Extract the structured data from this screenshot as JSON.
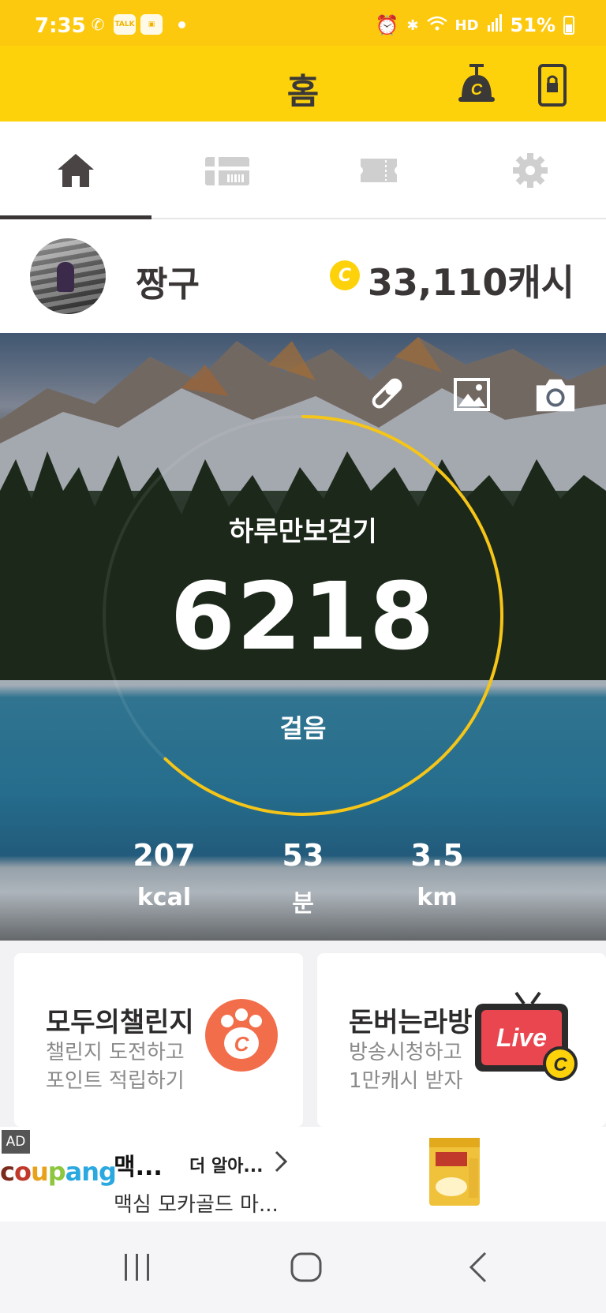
{
  "status_bar": {
    "time": "7:35",
    "left_icons": [
      "phone-alert-icon",
      "kakaotalk-icon",
      "kakao-story-icon"
    ],
    "right_icons": [
      "alarm-icon",
      "bluetooth-icon",
      "wifi-icon",
      "hd-voice-icon",
      "signal-icon"
    ],
    "hd_label": "HD",
    "battery": "51%"
  },
  "header": {
    "title": "홈",
    "accent_color": "#fdd20b"
  },
  "tabs": [
    {
      "icon": "home-icon",
      "selected": true
    },
    {
      "icon": "gift-card-icon",
      "selected": false
    },
    {
      "icon": "ticket-icon",
      "selected": false
    },
    {
      "icon": "gear-icon",
      "selected": false
    }
  ],
  "profile": {
    "name": "짱구",
    "coin_symbol": "C",
    "cash": "33,110캐시"
  },
  "hero": {
    "tools": [
      "pen-icon",
      "image-icon",
      "camera-icon"
    ],
    "title": "하루만보걷기",
    "steps": "6218",
    "steps_unit": "걸음",
    "goal_progress": 0.6218,
    "ring_color": "#f5c518",
    "stats": [
      {
        "value": "207",
        "unit": "kcal"
      },
      {
        "value": "53",
        "unit": "분"
      },
      {
        "value": "3.5",
        "unit": "km"
      }
    ]
  },
  "cards": [
    {
      "title": "모두의챌린지",
      "sub1": "챌린지 도전하고",
      "sub2": "포인트 적립하기",
      "icon": "paw-coin-icon"
    },
    {
      "title": "돈버는라방",
      "sub1": "방송시청하고",
      "sub2": "1만캐시 받자",
      "icon": "live-tv-icon",
      "badge": "Live"
    }
  ],
  "ad": {
    "tag": "AD",
    "brand": "coupang",
    "headline": "맥...",
    "cta": "더 알아...",
    "description": "맥심 모카골드 마..."
  },
  "nav": [
    "recents-icon",
    "home-circle-icon",
    "back-icon"
  ]
}
